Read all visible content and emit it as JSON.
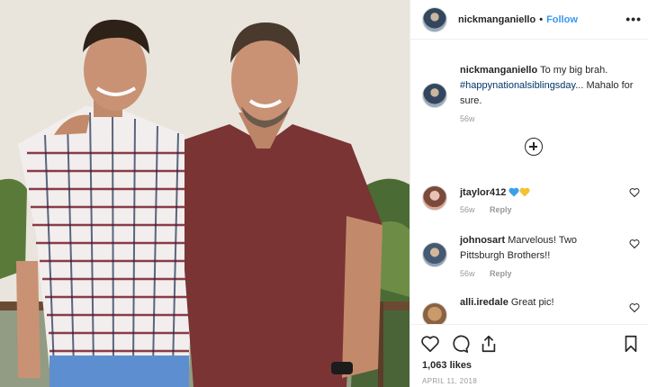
{
  "post": {
    "username": "nickmanganiello",
    "follow_label": "Follow",
    "separator": "•",
    "more_label": "•••"
  },
  "caption": {
    "username": "nickmanganiello",
    "text_before": "To my big brah.",
    "hashtag": "#happynationalsiblingsday",
    "text_after": "... Mahalo for sure.",
    "time": "56w"
  },
  "comments": [
    {
      "username": "jtaylor412",
      "text": "",
      "emoji": [
        "blue-heart-icon",
        "yellow-heart-icon"
      ],
      "time": "56w",
      "reply_label": "Reply"
    },
    {
      "username": "johnosart",
      "text": "Marvelous! Two Pittsburgh Brothers!!",
      "time": "56w",
      "reply_label": "Reply"
    },
    {
      "username": "alli.iredale",
      "text": "Great pic!",
      "time": "",
      "reply_label": ""
    }
  ],
  "actions": {
    "icons": [
      "heart-icon",
      "comment-icon",
      "share-icon",
      "bookmark-icon"
    ]
  },
  "likes": "1,063 likes",
  "date": "APRIL 11, 2018",
  "colors": {
    "link": "#3897f0",
    "hashtag": "#003569",
    "muted": "#999999",
    "text": "#262626"
  }
}
